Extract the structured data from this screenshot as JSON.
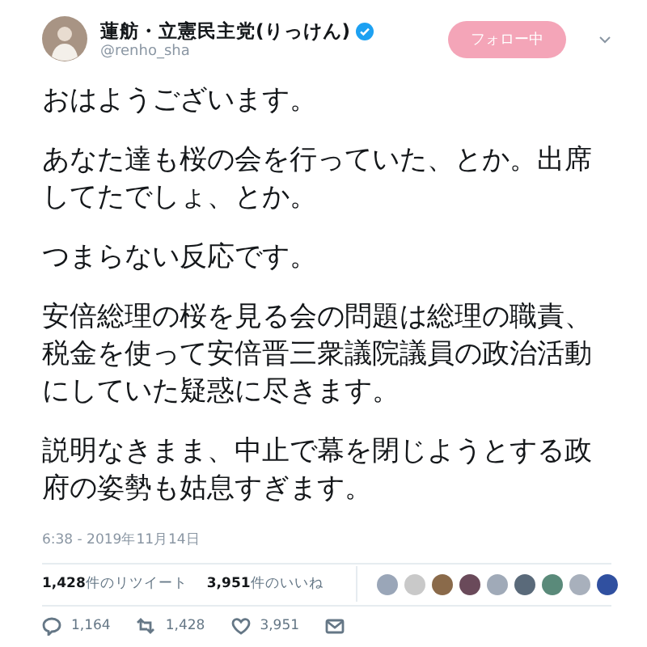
{
  "author": {
    "name": "蓮舫・立憲民主党(りっけん)",
    "handle": "@renho_sha",
    "verified": true
  },
  "follow_button": "フォロー中",
  "paragraphs": [
    "おはようございます。",
    "あなた達も桜の会を行っていた、とか。出席してたでしょ、とか。",
    "つまらない反応です。",
    "安倍総理の桜を見る会の問題は総理の職責、税金を使って安倍晋三衆議院議員の政治活動にしていた疑惑に尽きます。",
    "説明なきまま、中止で幕を閉じようとする政府の姿勢も姑息すぎます。"
  ],
  "timestamp": "6:38 - 2019年11月14日",
  "stats": [
    {
      "count": "1,428",
      "label": "件のリツイート"
    },
    {
      "count": "3,951",
      "label": "件のいいね"
    }
  ],
  "likers": [
    {
      "color": "#9aa6b8"
    },
    {
      "color": "#c9c9c9"
    },
    {
      "color": "#8a6a4a"
    },
    {
      "color": "#6a4a5a"
    },
    {
      "color": "#a0aab8"
    },
    {
      "color": "#5a6a7a"
    },
    {
      "color": "#5a8a7a"
    },
    {
      "color": "#a8b0bc"
    },
    {
      "color": "#3050a0"
    }
  ],
  "actions": [
    {
      "kind": "reply",
      "count": "1,164"
    },
    {
      "kind": "retweet",
      "count": "1,428"
    },
    {
      "kind": "like",
      "count": "3,951"
    },
    {
      "kind": "message"
    }
  ]
}
